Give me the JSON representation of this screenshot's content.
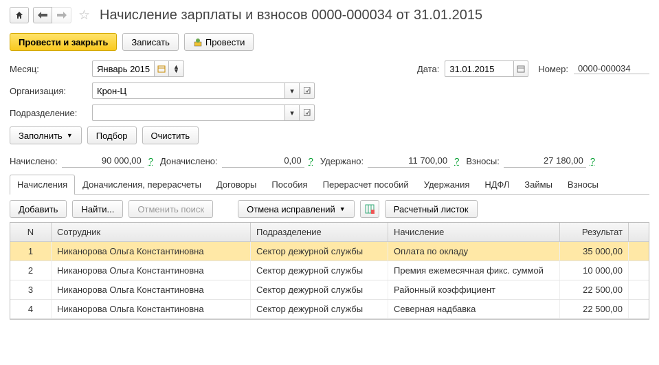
{
  "title": "Начисление зарплаты и взносов 0000-000034 от 31.01.2015",
  "buttons": {
    "post_close": "Провести и закрыть",
    "save": "Записать",
    "post": "Провести",
    "fill": "Заполнить",
    "select": "Подбор",
    "clear": "Очистить",
    "add": "Добавить",
    "find": "Найти...",
    "cancel_search": "Отменить поиск",
    "cancel_fix": "Отмена исправлений",
    "payslip": "Расчетный листок"
  },
  "labels": {
    "month": "Месяц:",
    "date": "Дата:",
    "number": "Номер:",
    "org": "Организация:",
    "dept": "Подразделение:",
    "accrued": "Начислено:",
    "add_accrued": "Доначислено:",
    "withheld": "Удержано:",
    "contrib": "Взносы:"
  },
  "fields": {
    "month": "Январь 2015",
    "date": "31.01.2015",
    "number": "0000-000034",
    "org": "Крон-Ц",
    "dept": ""
  },
  "totals": {
    "accrued": "90 000,00",
    "add_accrued": "0,00",
    "withheld": "11 700,00",
    "contrib": "27 180,00"
  },
  "tabs": [
    "Начисления",
    "Доначисления, перерасчеты",
    "Договоры",
    "Пособия",
    "Перерасчет пособий",
    "Удержания",
    "НДФЛ",
    "Займы",
    "Взносы"
  ],
  "columns": {
    "n": "N",
    "emp": "Сотрудник",
    "dep": "Подразделение",
    "acc": "Начисление",
    "res": "Результат"
  },
  "chart_data": {
    "type": "table",
    "columns": [
      "N",
      "Сотрудник",
      "Подразделение",
      "Начисление",
      "Результат"
    ],
    "rows": [
      {
        "n": "1",
        "emp": "Никанорова Ольга Константиновна",
        "dep": "Сектор дежурной службы",
        "acc": "Оплата по окладу",
        "res": "35 000,00",
        "sel": true
      },
      {
        "n": "2",
        "emp": "Никанорова Ольга Константиновна",
        "dep": "Сектор дежурной службы",
        "acc": "Премия ежемесячная фикс. суммой",
        "res": "10 000,00"
      },
      {
        "n": "3",
        "emp": "Никанорова Ольга Константиновна",
        "dep": "Сектор дежурной службы",
        "acc": "Районный коэффициент",
        "res": "22 500,00"
      },
      {
        "n": "4",
        "emp": "Никанорова Ольга Константиновна",
        "dep": "Сектор дежурной службы",
        "acc": "Северная надбавка",
        "res": "22 500,00"
      }
    ]
  }
}
